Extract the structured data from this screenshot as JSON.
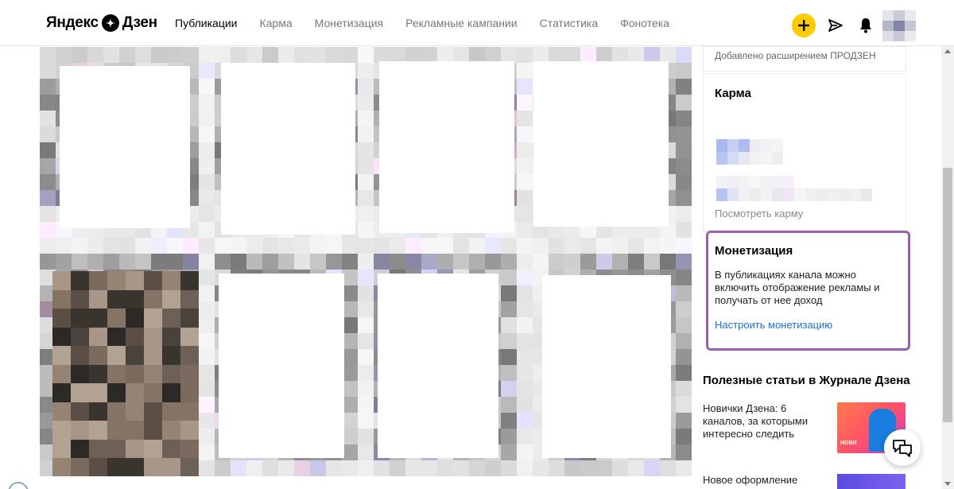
{
  "header": {
    "logo_text": "Яндекс",
    "logo_text2": "Дзен",
    "nav": [
      {
        "label": "Публикации",
        "active": true
      },
      {
        "label": "Карма",
        "active": false
      },
      {
        "label": "Монетизация",
        "active": false
      },
      {
        "label": "Рекламные кампании",
        "active": false
      },
      {
        "label": "Статистика",
        "active": false
      },
      {
        "label": "Фонотека",
        "active": false
      }
    ],
    "icons": [
      "plus-icon",
      "send-icon",
      "bell-icon",
      "avatar"
    ],
    "accent": "#ffcc00"
  },
  "sidebar": {
    "prozen_text": "Добавлено расширением ПРОДЗЕН",
    "karma": {
      "title": "Карма",
      "link": "Посмотреть карму"
    },
    "monetization": {
      "title": "Монетизация",
      "description": "В публикациях канала можно включить отображение рекламы и получать от нее доход",
      "link": "Настроить монетизацию",
      "highlight_color": "#9b5fb0",
      "link_color": "#1a6fd6"
    },
    "articles": {
      "title": "Полезные статьи в Журнале Дзена",
      "items": [
        {
          "text": "Новички Дзена: 6 каналов, за которыми интересно следить",
          "thumb_label": "НОВИ"
        },
        {
          "text": "Новое оформление"
        }
      ]
    }
  },
  "icons": {
    "chat": "chat-bubbles-icon"
  }
}
